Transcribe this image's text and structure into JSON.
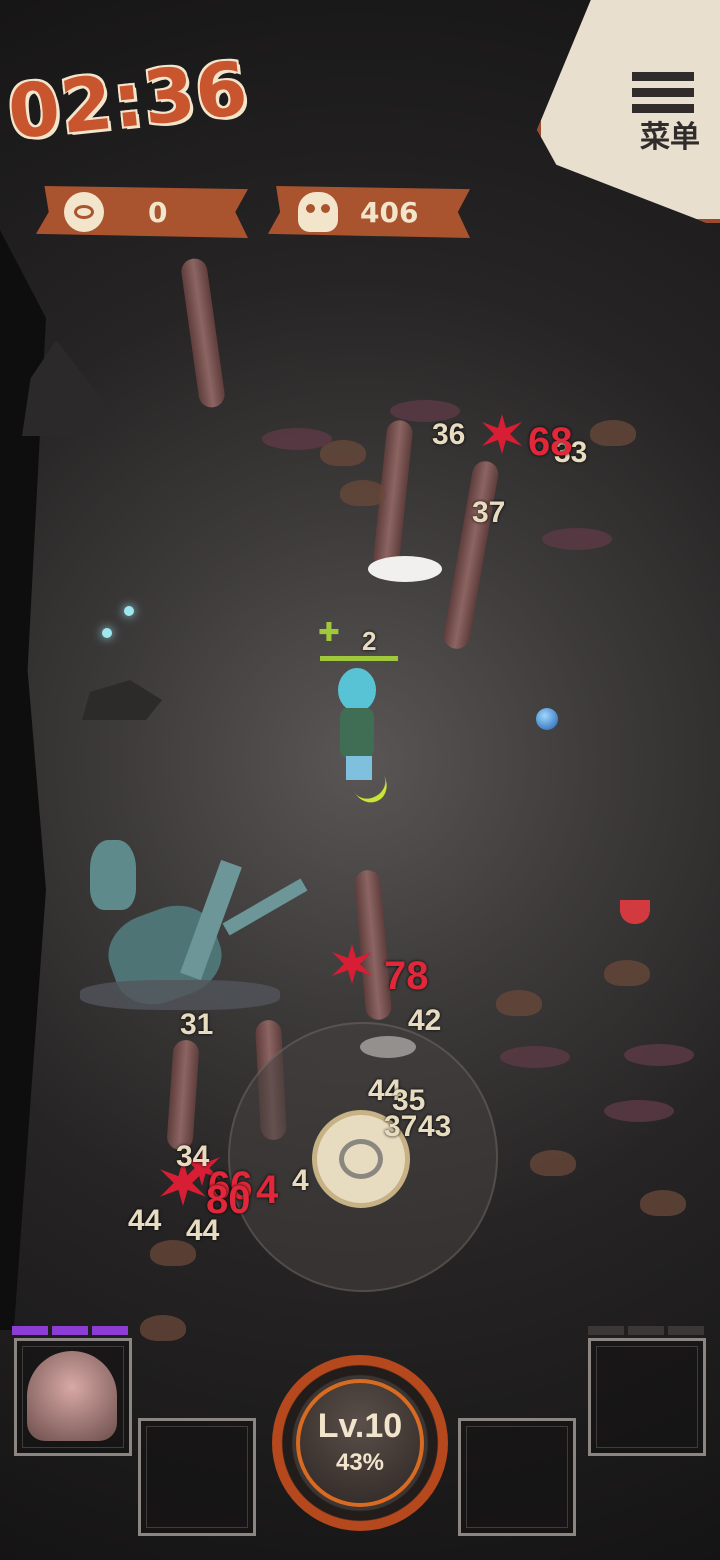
{
  "hud": {
    "timer": "02:36",
    "coin_count": "0",
    "kill_count": "406",
    "menu_label": "菜单"
  },
  "player": {
    "heal_value": "2"
  },
  "damage_numbers": {
    "white": [
      "36",
      "33",
      "37",
      "31",
      "42",
      "44",
      "35",
      "37",
      "43",
      "44",
      "44",
      "34",
      "4"
    ],
    "red": [
      "68",
      "78",
      "66",
      "80",
      "4"
    ]
  },
  "level": {
    "label": "Lv.10",
    "progress_text": "43%",
    "progress_fraction": 0.43
  },
  "xp_segments_filled": 3,
  "icons": [
    "timer",
    "eye-coin-icon",
    "skull-icon",
    "menu-icon",
    "heal-plus-icon",
    "joystick-icon"
  ],
  "colors": {
    "accent_orange": "#c9552f",
    "parchment": "#e9dfcf",
    "damage_red": "#e0283a",
    "damage_white": "#e8dcc0",
    "xp_purple": "#8e3cd6",
    "hp_green": "#9fc83a"
  }
}
